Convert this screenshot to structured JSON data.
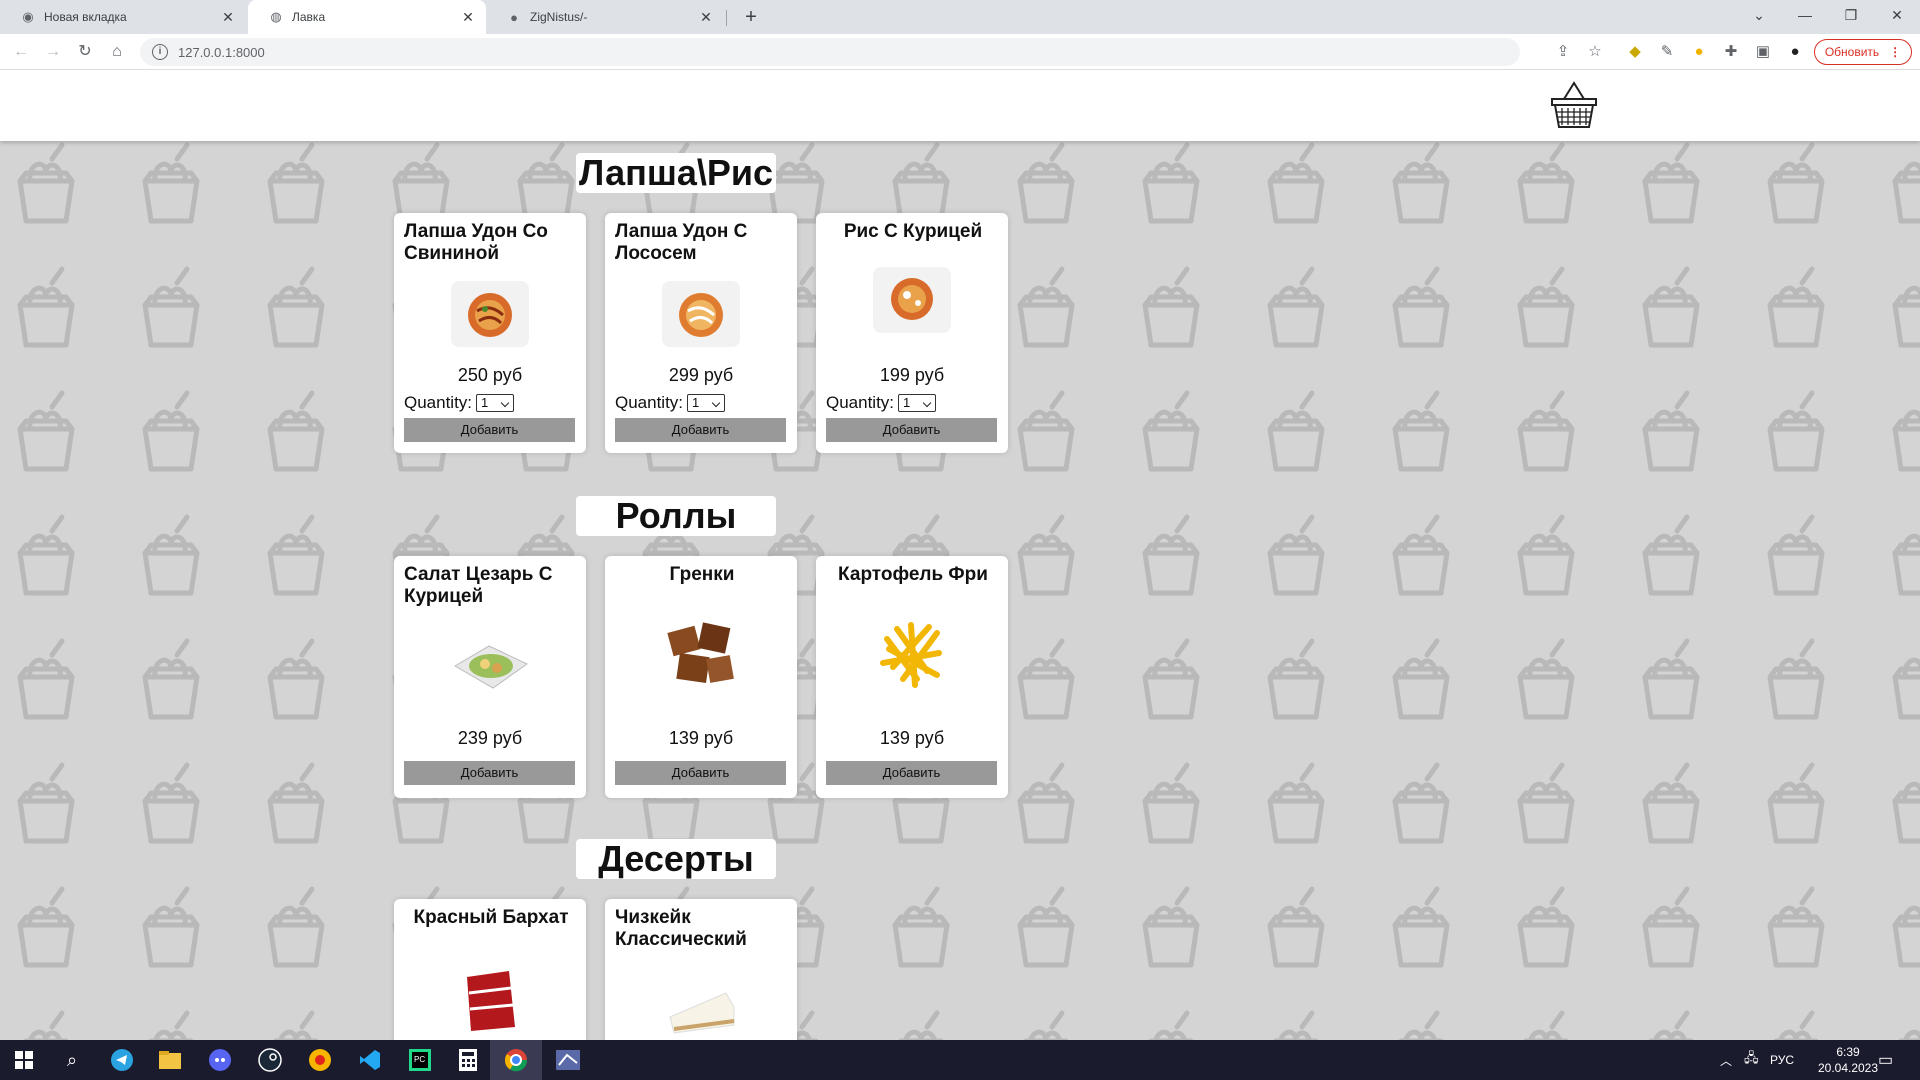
{
  "browser": {
    "tabs": [
      {
        "title": "Новая вкладка",
        "icon": "chrome-icon",
        "active": false
      },
      {
        "title": "Лавка",
        "icon": "globe-icon",
        "active": true
      },
      {
        "title": "ZigNistus/-",
        "icon": "github-icon",
        "active": false
      }
    ],
    "url": "127.0.0.1:8000",
    "update_label": "Обновить"
  },
  "menu": {
    "sections": [
      {
        "title": "Лапша\\Рис",
        "items": [
          {
            "name": "Лапша Удон Со Свининой",
            "price": "250 руб",
            "quantity_label": "Quantity:",
            "quantity": "1",
            "button": "Добавить"
          },
          {
            "name": "Лапша Удон С Лососем",
            "price": "299 руб",
            "quantity_label": "Quantity:",
            "quantity": "1",
            "button": "Добавить"
          },
          {
            "name": "Рис С Курицей",
            "price": "199 руб",
            "quantity_label": "Quantity:",
            "quantity": "1",
            "button": "Добавить"
          }
        ]
      },
      {
        "title": "Роллы",
        "items": [
          {
            "name": "Салат Цезарь С Курицей",
            "price": "239 руб",
            "button": "Добавить"
          },
          {
            "name": "Гренки",
            "price": "139 руб",
            "button": "Добавить"
          },
          {
            "name": "Картофель Фри",
            "price": "139 руб",
            "button": "Добавить"
          }
        ]
      },
      {
        "title": "Десерты",
        "items": [
          {
            "name": "Красный Бархат"
          },
          {
            "name": "Чизкейк Классический"
          }
        ]
      }
    ]
  },
  "taskbar": {
    "language": "РУС",
    "time": "6:39",
    "date": "20.04.2023"
  }
}
